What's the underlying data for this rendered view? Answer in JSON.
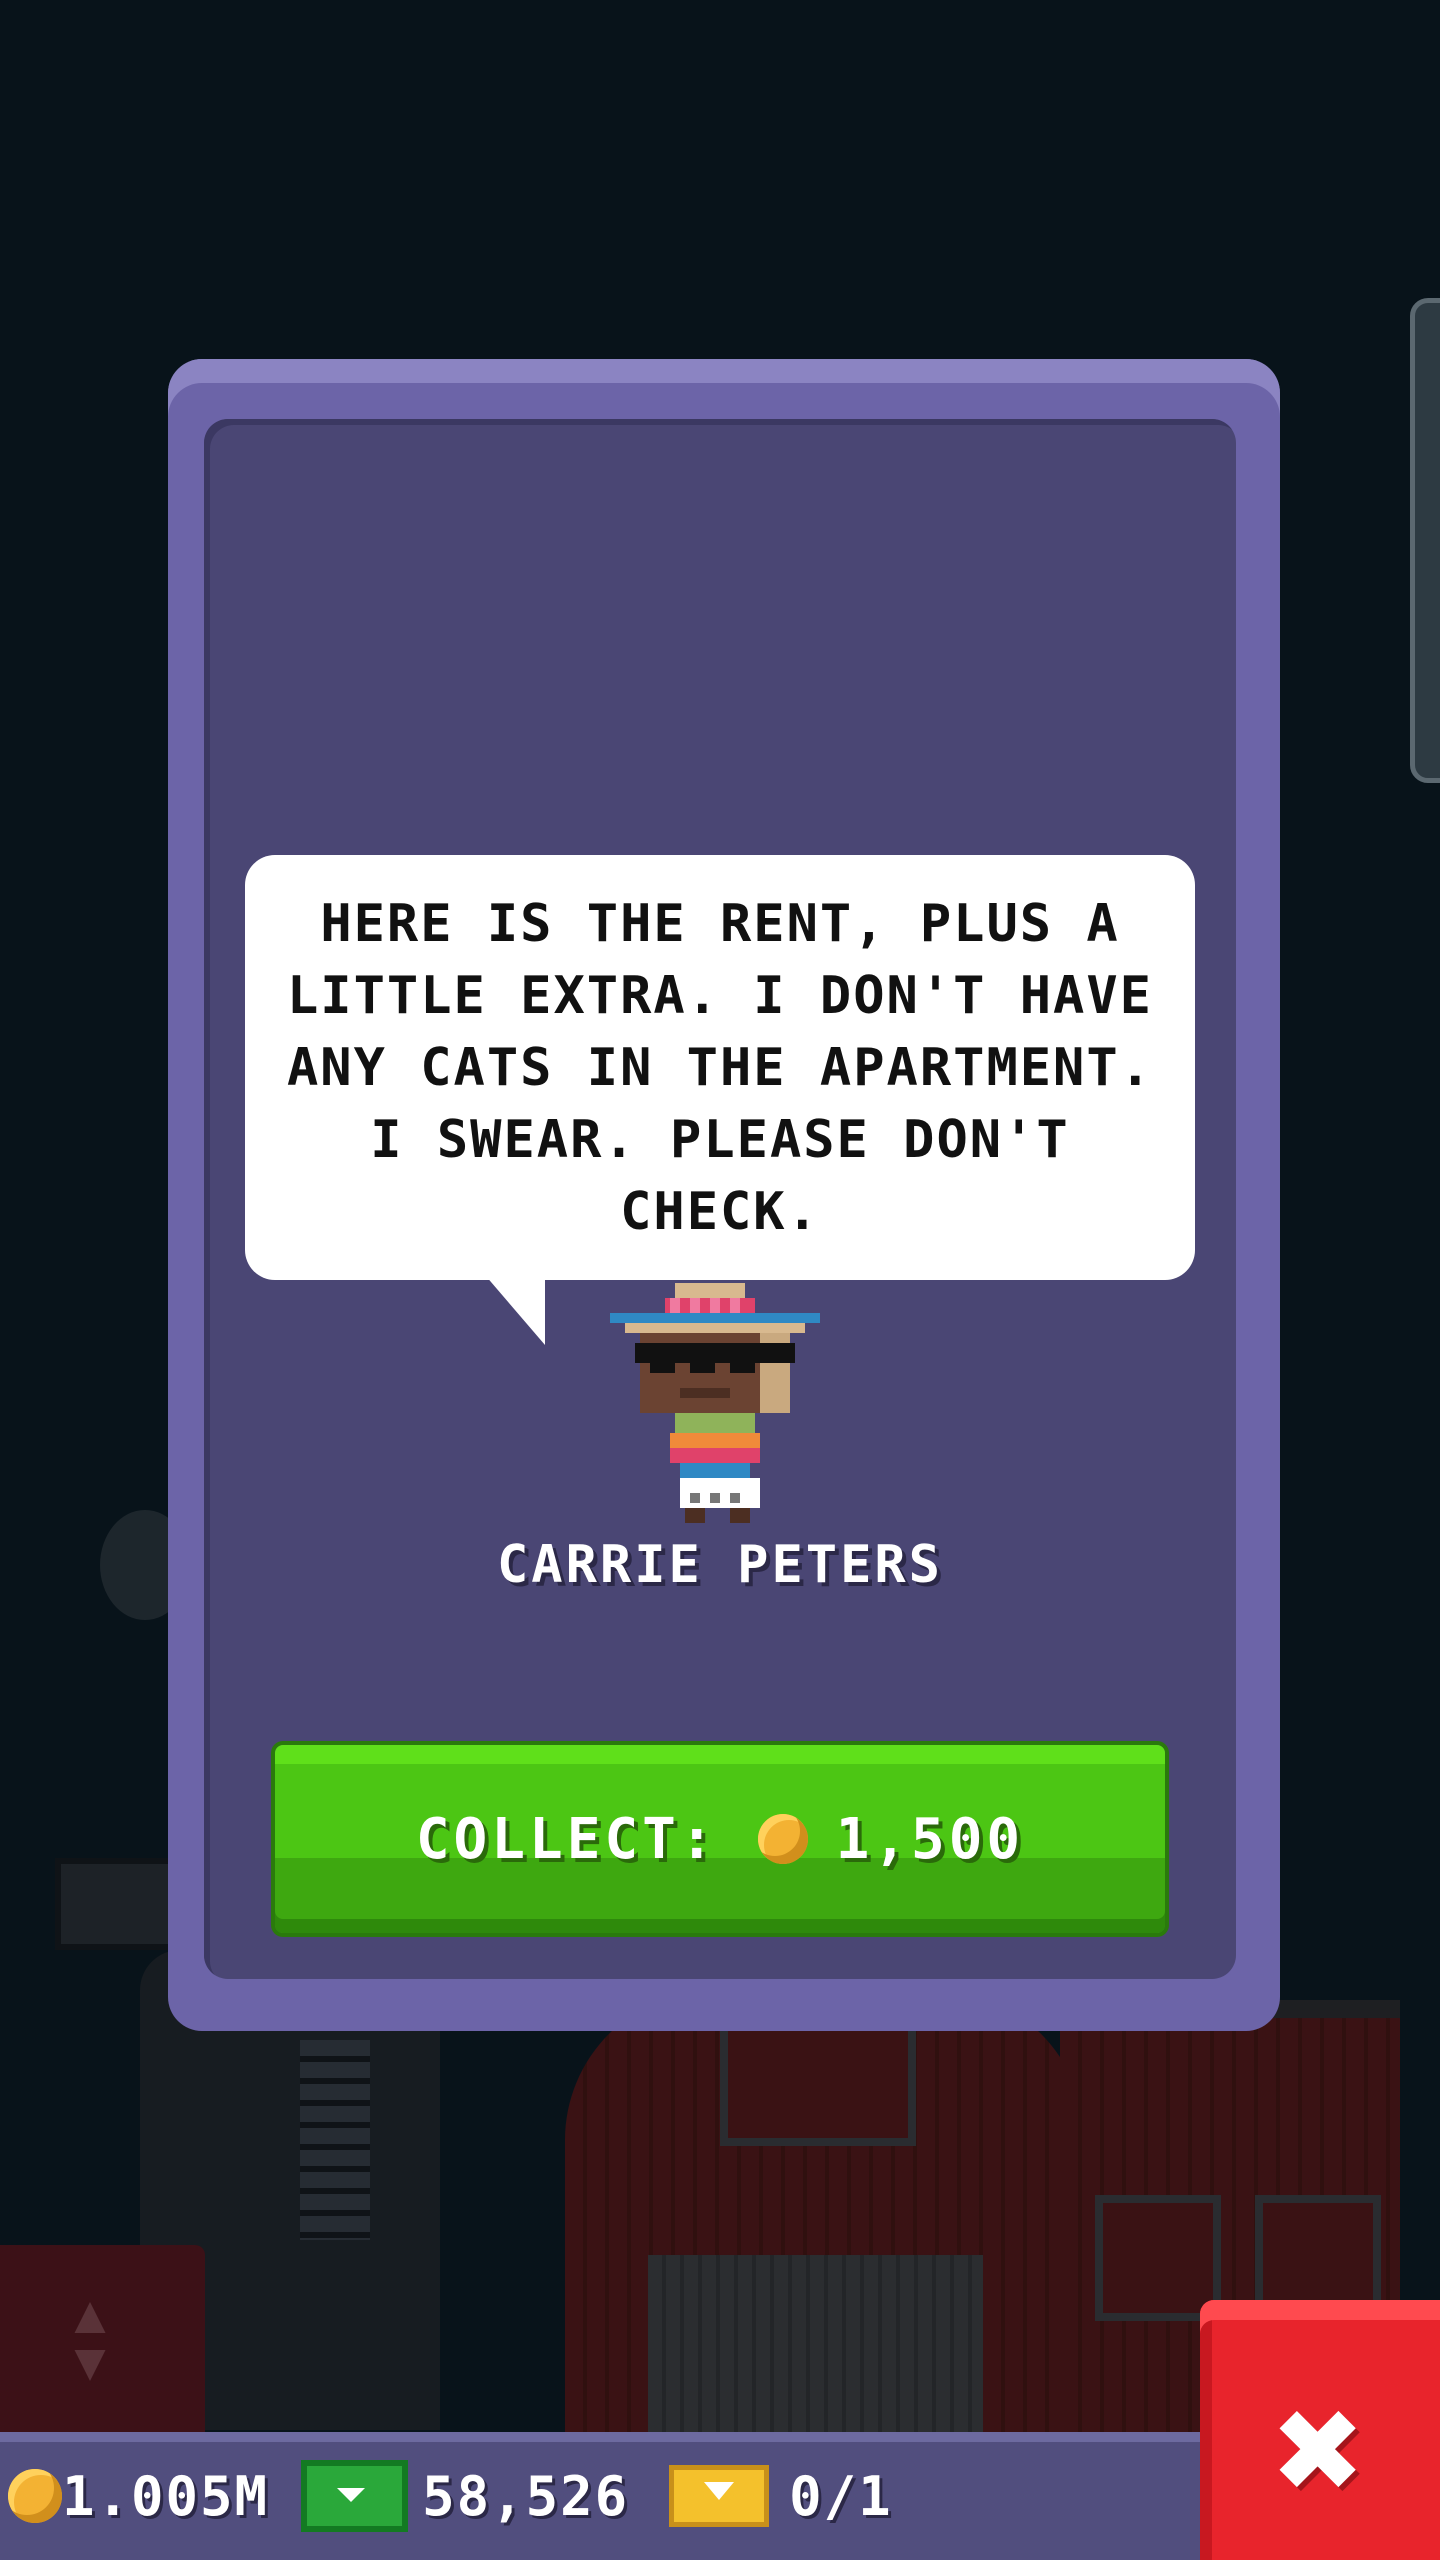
{
  "dialog": {
    "message": "HERE IS THE RENT, PLUS A LITTLE EXTRA. I DON'T HAVE ANY CATS IN THE APARTMENT. I SWEAR. PLEASE DON'T CHECK.",
    "tenant_name": "CARRIE PETERS",
    "collect_label": "COLLECT:",
    "collect_amount": "1,500",
    "collect_icon": "coin-icon"
  },
  "status_bar": {
    "coins": "1.005M",
    "coins_icon": "coin-icon",
    "bux": "58,526",
    "bux_icon": "cash-icon",
    "tickets": "0/1",
    "tickets_icon": "ticket-icon"
  },
  "close_button": {
    "icon": "close-x-icon",
    "glyph": "✖"
  },
  "colors": {
    "dialog_frame": "#6c64a8",
    "dialog_fill": "#4a4674",
    "collect_green": "#4cc614",
    "close_red": "#e8242c",
    "status_bar": "#514e7e"
  }
}
